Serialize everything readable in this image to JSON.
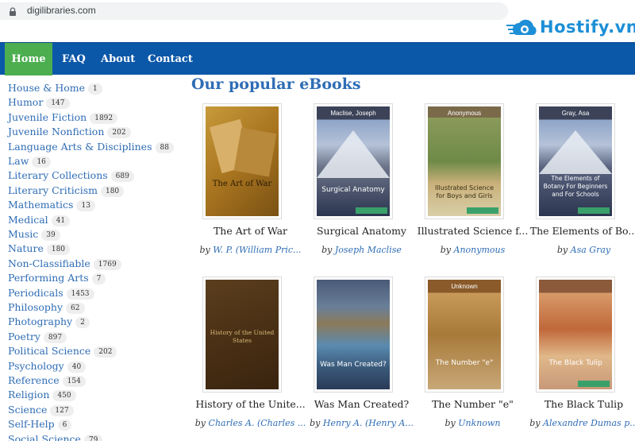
{
  "browser": {
    "url": "digilibraries.com"
  },
  "watermark": {
    "text": "Hostify.vn"
  },
  "nav": {
    "home": "Home",
    "faq": "FAQ",
    "about": "About",
    "contact": "Contact"
  },
  "sidebar": {
    "items": [
      {
        "name": "House & Home",
        "count": "1"
      },
      {
        "name": "Humor",
        "count": "147"
      },
      {
        "name": "Juvenile Fiction",
        "count": "1892"
      },
      {
        "name": "Juvenile Nonfiction",
        "count": "202"
      },
      {
        "name": "Language Arts & Disciplines",
        "count": "88"
      },
      {
        "name": "Law",
        "count": "16"
      },
      {
        "name": "Literary Collections",
        "count": "689"
      },
      {
        "name": "Literary Criticism",
        "count": "180"
      },
      {
        "name": "Mathematics",
        "count": "13"
      },
      {
        "name": "Medical",
        "count": "41"
      },
      {
        "name": "Music",
        "count": "39"
      },
      {
        "name": "Nature",
        "count": "180"
      },
      {
        "name": "Non-Classifiable",
        "count": "1769"
      },
      {
        "name": "Performing Arts",
        "count": "7"
      },
      {
        "name": "Periodicals",
        "count": "1453"
      },
      {
        "name": "Philosophy",
        "count": "62"
      },
      {
        "name": "Photography",
        "count": "2"
      },
      {
        "name": "Poetry",
        "count": "897"
      },
      {
        "name": "Political Science",
        "count": "202"
      },
      {
        "name": "Psychology",
        "count": "40"
      },
      {
        "name": "Reference",
        "count": "154"
      },
      {
        "name": "Religion",
        "count": "450"
      },
      {
        "name": "Science",
        "count": "127"
      },
      {
        "name": "Self-Help",
        "count": "6"
      },
      {
        "name": "Social Science",
        "count": "79"
      }
    ]
  },
  "main": {
    "heading": "Our popular eBooks",
    "by": "by",
    "books": [
      {
        "title": "The Art of War",
        "author": "W. P. (William Pric...",
        "cover_author": "",
        "cover_title": "The Art of War"
      },
      {
        "title": "Surgical Anatomy",
        "author": "Joseph Maclise",
        "cover_author": "Maclise, Joseph",
        "cover_title": "Surgical Anatomy"
      },
      {
        "title": "Illustrated Science f...",
        "author": "Anonymous",
        "cover_author": "Anonymous",
        "cover_title": "Illustrated Science for Boys and Girls"
      },
      {
        "title": "The Elements of Bo...",
        "author": "Asa Gray",
        "cover_author": "Gray, Asa",
        "cover_title": "The Elements of Botany For Beginners and For Schools"
      },
      {
        "title": "History of the Unite...",
        "author": "Charles A. (Charles ...",
        "cover_author": "",
        "cover_title": "History of the United States"
      },
      {
        "title": "Was Man Created?",
        "author": "Henry A. (Henry A...",
        "cover_author": "",
        "cover_title": "Was Man Created?"
      },
      {
        "title": "The Number \"e\"",
        "author": "Unknown",
        "cover_author": "Unknown",
        "cover_title": "The Number \"e\""
      },
      {
        "title": "The Black Tulip",
        "author": "Alexandre Dumas p...",
        "cover_author": "",
        "cover_title": "The Black Tulip"
      }
    ]
  },
  "colors": {
    "navbar": "#0b57a8",
    "active_tab": "#4cae4f",
    "link": "#2f6db5",
    "watermark": "#1d8fd6"
  },
  "icons": {
    "lock": "lock-icon",
    "logo": "hostify-logo-icon"
  }
}
